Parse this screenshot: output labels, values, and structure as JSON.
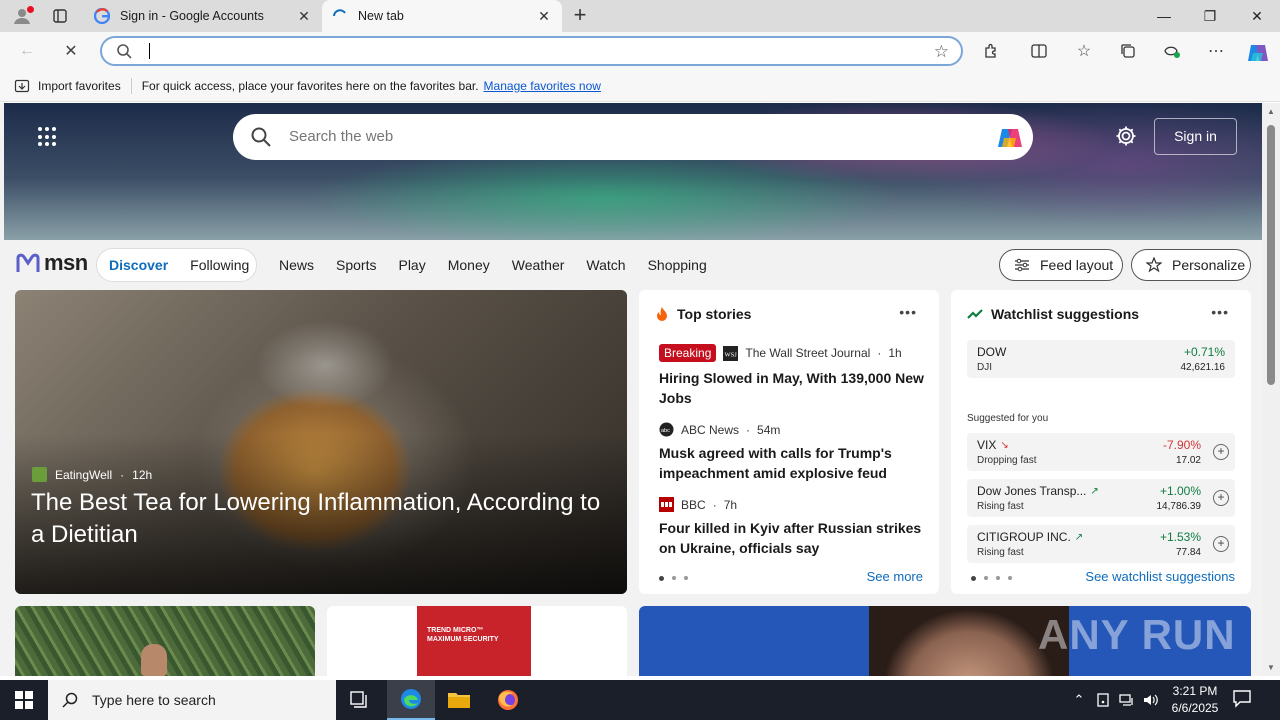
{
  "tabs": [
    {
      "title": "Sign in - Google Accounts",
      "icon": "google-icon"
    },
    {
      "title": "New tab",
      "icon": "loading-spinner-icon"
    }
  ],
  "window_controls": [
    "minimize",
    "restore",
    "close"
  ],
  "toolbar": {
    "address_value": "",
    "icons": [
      "back-icon",
      "stop-loading-icon",
      "extensions-icon",
      "split-screen-icon",
      "favorites-icon",
      "collections-icon",
      "browser-essentials-icon",
      "more-icon",
      "copilot-icon"
    ]
  },
  "favbar": {
    "import_label": "Import favorites",
    "message": "For quick access, place your favorites here on the favorites bar.",
    "link": "Manage favorites now"
  },
  "hero": {
    "search_placeholder": "Search the web",
    "signin_label": "Sign in"
  },
  "msn": {
    "logo": "msn",
    "pills": [
      "Discover",
      "Following"
    ],
    "nav": [
      "News",
      "Sports",
      "Play",
      "Money",
      "Weather",
      "Watch",
      "Shopping"
    ],
    "feed_layout": "Feed layout",
    "personalize": "Personalize"
  },
  "feature": {
    "source": "EatingWell",
    "age": "12h",
    "headline": "The Best Tea for Lowering Inflammation, According to a Dietitian"
  },
  "top_stories": {
    "title": "Top stories",
    "breaking": "Breaking",
    "items": [
      {
        "source": "The Wall Street Journal",
        "age": "1h",
        "headline": "Hiring Slowed in May, With 139,000 New Jobs"
      },
      {
        "source": "ABC News",
        "age": "54m",
        "headline": "Musk agreed with calls for Trump's impeachment amid explosive feud"
      },
      {
        "source": "BBC",
        "age": "7h",
        "headline": "Four killed in Kyiv after Russian strikes on Ukraine, officials say"
      }
    ],
    "see_more": "See more"
  },
  "watchlist": {
    "title": "Watchlist suggestions",
    "dow": {
      "name": "DOW",
      "sub": "DJI",
      "change": "+0.71%",
      "price": "42,621.16"
    },
    "suggested_label": "Suggested for you",
    "suggestions": [
      {
        "name": "VIX",
        "status": "Dropping fast",
        "change": "-7.90%",
        "price": "17.02",
        "dir": "down"
      },
      {
        "name": "Dow Jones Transp...",
        "status": "Rising fast",
        "change": "+1.00%",
        "price": "14,786.39",
        "dir": "up"
      },
      {
        "name": "CITIGROUP INC.",
        "status": "Rising fast",
        "change": "+1.53%",
        "price": "77.84",
        "dir": "up"
      }
    ],
    "see_more": "See watchlist suggestions"
  },
  "promo": {
    "product_line1": "TREND MICRO™",
    "product_line2": "MAXIMUM SECURITY"
  },
  "watermark": "ANY RUN",
  "taskbar": {
    "search_placeholder": "Type here to search",
    "time": "3:21 PM",
    "date": "6/6/2025"
  },
  "colors": {
    "accent": "#0f6cbd",
    "up": "#107c41",
    "down": "#d13438",
    "breaking": "#c50f1f"
  }
}
